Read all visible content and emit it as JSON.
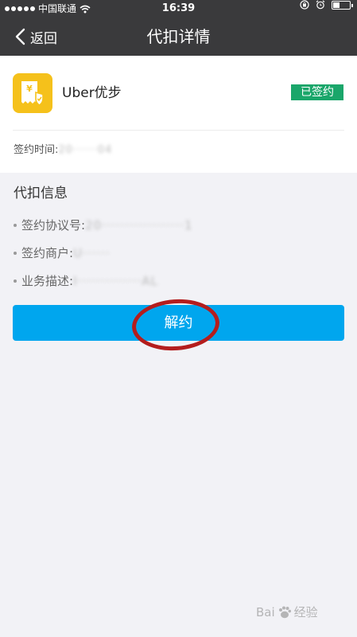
{
  "status_bar": {
    "carrier": "中国联通",
    "time": "16:39"
  },
  "nav": {
    "back_label": "返回",
    "title": "代扣详情"
  },
  "merchant": {
    "name": "Uber优步",
    "status_badge": "已签约",
    "sign_time_label": "签约时间:",
    "sign_time_value": "20······04"
  },
  "info": {
    "title": "代扣信息",
    "rows": [
      {
        "label": "签约协议号:",
        "value": "20··················1"
      },
      {
        "label": "签约商户:",
        "value": "U······"
      },
      {
        "label": "业务描述:",
        "value": "I··············AL"
      }
    ]
  },
  "action": {
    "button_label": "解约"
  },
  "watermark": {
    "text_left": "Bai",
    "text_right": "经验"
  },
  "colors": {
    "header_bg": "#3a3a3c",
    "badge_green": "#1aa66a",
    "button_blue": "#00a6ee",
    "annotation_red": "#b41d1d",
    "app_icon_yellow": "#f5c11b"
  }
}
